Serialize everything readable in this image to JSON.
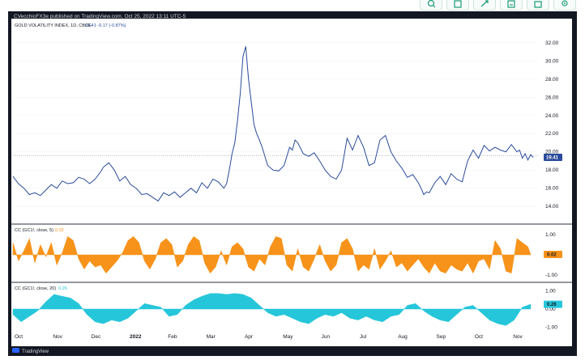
{
  "toolbar": {
    "icons": [
      "zoom-icon",
      "snapshot-icon",
      "fullscreen-icon",
      "save-icon",
      "share-icon",
      "settings-icon"
    ]
  },
  "header": {
    "publish_line": "CVecchioFX3e published on TradingView.com, Oct 25, 2022 13:11 UTC-5"
  },
  "branding": {
    "text": "TradingView"
  },
  "chart_data": [
    {
      "type": "line",
      "legend": "GOLD VOLATILITY INDEX, 1D, CBOE",
      "legend_values": "19.41  -0.17 (-0.87%)",
      "last_value_label": "19.41",
      "color": "#2a4a9a",
      "ylim": [
        12.5,
        33.5
      ],
      "yticks": [
        "32.00",
        "30.00",
        "28.00",
        "26.00",
        "24.00",
        "22.00",
        "20.00",
        "18.00",
        "16.00",
        "14.00"
      ],
      "reference_line": 19.6,
      "x_range": [
        0,
        384
      ],
      "x": [
        0,
        4,
        8,
        12,
        16,
        20,
        24,
        28,
        32,
        36,
        40,
        44,
        48,
        52,
        56,
        60,
        64,
        66,
        70,
        74,
        78,
        82,
        86,
        90,
        94,
        98,
        102,
        106,
        110,
        114,
        118,
        122,
        126,
        130,
        134,
        138,
        142,
        146,
        150,
        154,
        156,
        158,
        160,
        162,
        164,
        166,
        168,
        170,
        172,
        174,
        176,
        178,
        180,
        182,
        186,
        190,
        194,
        198,
        200,
        202,
        204,
        206,
        208,
        212,
        216,
        220,
        224,
        228,
        232,
        236,
        240,
        244,
        248,
        252,
        256,
        260,
        264,
        268,
        272,
        276,
        280,
        284,
        288,
        292,
        296,
        298,
        300,
        302,
        304,
        308,
        312,
        316,
        320,
        324,
        328,
        332,
        336,
        340,
        344,
        348,
        352,
        356,
        360,
        364,
        368,
        370,
        372,
        374,
        376,
        378,
        380
      ],
      "values": [
        17.3,
        16.5,
        16.0,
        15.3,
        15.5,
        15.2,
        15.8,
        16.4,
        16.0,
        16.8,
        16.5,
        16.6,
        17.2,
        17.0,
        16.5,
        17.0,
        17.8,
        18.3,
        18.8,
        18.0,
        16.8,
        17.3,
        16.4,
        16.0,
        15.3,
        15.4,
        15.0,
        14.6,
        15.5,
        15.2,
        15.6,
        15.0,
        15.5,
        16.0,
        15.5,
        16.6,
        16.0,
        17.0,
        16.7,
        16.0,
        16.5,
        18.0,
        19.8,
        21.0,
        23.5,
        26.5,
        30.5,
        31.6,
        28.0,
        25.5,
        23.0,
        22.0,
        21.3,
        20.5,
        18.5,
        18.0,
        17.9,
        18.5,
        19.5,
        20.5,
        20.2,
        21.3,
        21.0,
        19.8,
        19.5,
        19.9,
        19.0,
        18.0,
        17.3,
        17.0,
        18.0,
        21.5,
        20.2,
        21.8,
        20.5,
        18.5,
        18.8,
        21.3,
        21.8,
        20.0,
        19.0,
        18.2,
        17.2,
        17.5,
        16.6,
        16.0,
        15.3,
        15.6,
        15.5,
        16.6,
        17.3,
        16.4,
        17.6,
        17.0,
        16.7,
        19.0,
        20.2,
        19.3,
        20.7,
        20.1,
        20.5,
        20.2,
        20.0,
        20.8,
        20.0,
        20.2,
        19.3,
        19.8,
        19.1,
        19.7,
        19.4
      ]
    },
    {
      "type": "area",
      "legend": "CC (GC1!, close, 5)",
      "legend_value": "0.02",
      "last_value_label": "0.02",
      "color": "#f7931a",
      "ylim": [
        -1.15,
        1.15
      ],
      "baseline": 0,
      "yticks": [
        "1.00",
        "-1.00"
      ],
      "x_range": [
        0,
        384
      ],
      "x": [
        0,
        4,
        8,
        12,
        16,
        20,
        24,
        28,
        32,
        36,
        40,
        44,
        48,
        52,
        56,
        60,
        64,
        68,
        72,
        76,
        80,
        84,
        88,
        92,
        96,
        100,
        104,
        108,
        112,
        116,
        120,
        124,
        128,
        132,
        136,
        140,
        144,
        148,
        152,
        156,
        160,
        164,
        168,
        172,
        176,
        180,
        184,
        188,
        192,
        196,
        200,
        204,
        208,
        212,
        216,
        220,
        224,
        228,
        232,
        236,
        240,
        244,
        248,
        252,
        256,
        260,
        264,
        268,
        272,
        276,
        280,
        284,
        288,
        292,
        296,
        300,
        304,
        308,
        312,
        316,
        320,
        324,
        328,
        332,
        336,
        340,
        344,
        348,
        352,
        356,
        360,
        364,
        368,
        372,
        376,
        378
      ],
      "values": [
        0.6,
        -0.3,
        0.2,
        0.8,
        -0.4,
        0.5,
        -0.1,
        0.6,
        -0.5,
        0.1,
        0.9,
        0.7,
        -0.2,
        -0.7,
        -0.3,
        -0.6,
        -0.5,
        -0.9,
        -0.6,
        -0.3,
        0.1,
        0.7,
        0.9,
        0.6,
        -0.3,
        -0.7,
        -0.2,
        0.6,
        0.8,
        0.5,
        -0.6,
        -0.3,
        0.5,
        0.9,
        0.7,
        -0.4,
        -0.9,
        -0.6,
        0.2,
        -0.5,
        0.4,
        0.6,
        0.3,
        -0.6,
        -0.8,
        -0.2,
        -0.5,
        0.4,
        0.9,
        0.8,
        -0.5,
        -0.8,
        0.3,
        -0.6,
        -0.8,
        -0.2,
        0.5,
        -0.3,
        -0.8,
        -0.5,
        0.6,
        0.8,
        0.3,
        -0.8,
        -0.5,
        -0.7,
        0.3,
        -0.7,
        -0.3,
        0.2,
        -0.6,
        -0.4,
        -0.8,
        -0.5,
        -0.2,
        -0.6,
        -0.9,
        -0.4,
        -0.8,
        -0.9,
        -0.5,
        -0.7,
        -0.8,
        -0.4,
        -0.9,
        -0.3,
        -0.2,
        -0.7,
        0.7,
        0.3,
        -0.8,
        -0.9,
        0.8,
        0.6,
        0.4,
        0.02
      ]
    },
    {
      "type": "area",
      "legend": "CC (GC1!, close, 20)",
      "legend_value": "0.26",
      "last_value_label": "0.26",
      "color": "#26c6da",
      "ylim": [
        -1.15,
        1.15
      ],
      "baseline": 0,
      "yticks": [
        "1.00",
        "0.00",
        "-1.00"
      ],
      "x_range": [
        0,
        384
      ],
      "x": [
        0,
        6,
        12,
        18,
        24,
        30,
        36,
        42,
        48,
        54,
        60,
        66,
        72,
        78,
        84,
        90,
        96,
        102,
        108,
        114,
        120,
        126,
        132,
        138,
        144,
        150,
        156,
        162,
        168,
        174,
        180,
        186,
        192,
        198,
        204,
        210,
        216,
        222,
        228,
        234,
        240,
        246,
        252,
        258,
        264,
        270,
        276,
        282,
        288,
        294,
        300,
        306,
        312,
        318,
        324,
        330,
        336,
        342,
        348,
        354,
        360,
        366,
        372,
        378
      ],
      "values": [
        -0.3,
        -0.7,
        -0.4,
        -0.1,
        0.4,
        0.8,
        0.7,
        0.6,
        0.3,
        -0.3,
        -0.7,
        -0.8,
        -0.6,
        -0.7,
        -0.5,
        -0.1,
        0.3,
        0.2,
        0.1,
        -0.4,
        -0.3,
        0.2,
        0.5,
        0.7,
        0.85,
        0.85,
        0.8,
        0.85,
        0.8,
        0.6,
        0.2,
        -0.2,
        -0.4,
        -0.3,
        -0.5,
        -0.7,
        -0.8,
        -0.5,
        -0.3,
        -0.4,
        -0.2,
        -0.5,
        -0.6,
        -0.4,
        -0.6,
        -0.7,
        -0.4,
        -0.3,
        0.2,
        0.3,
        -0.1,
        -0.4,
        -0.6,
        -0.7,
        -0.3,
        0.1,
        0.2,
        -0.2,
        -0.6,
        -0.8,
        -0.9,
        -0.6,
        0.1,
        0.26
      ]
    }
  ],
  "x_axis": {
    "ticks": [
      {
        "label": "Oct",
        "x": 0,
        "bold": false
      },
      {
        "label": "Nov",
        "x": 28,
        "bold": false
      },
      {
        "label": "Dec",
        "x": 56,
        "bold": false
      },
      {
        "label": "2022",
        "x": 84,
        "bold": true
      },
      {
        "label": "Feb",
        "x": 112,
        "bold": false
      },
      {
        "label": "Mar",
        "x": 140,
        "bold": false
      },
      {
        "label": "Apr",
        "x": 168,
        "bold": false
      },
      {
        "label": "May",
        "x": 196,
        "bold": false
      },
      {
        "label": "Jun",
        "x": 224,
        "bold": false
      },
      {
        "label": "Jul",
        "x": 252,
        "bold": false
      },
      {
        "label": "Aug",
        "x": 280,
        "bold": false
      },
      {
        "label": "Sep",
        "x": 308,
        "bold": false
      },
      {
        "label": "Oct",
        "x": 336,
        "bold": false
      },
      {
        "label": "Nov",
        "x": 364,
        "bold": false
      }
    ]
  }
}
